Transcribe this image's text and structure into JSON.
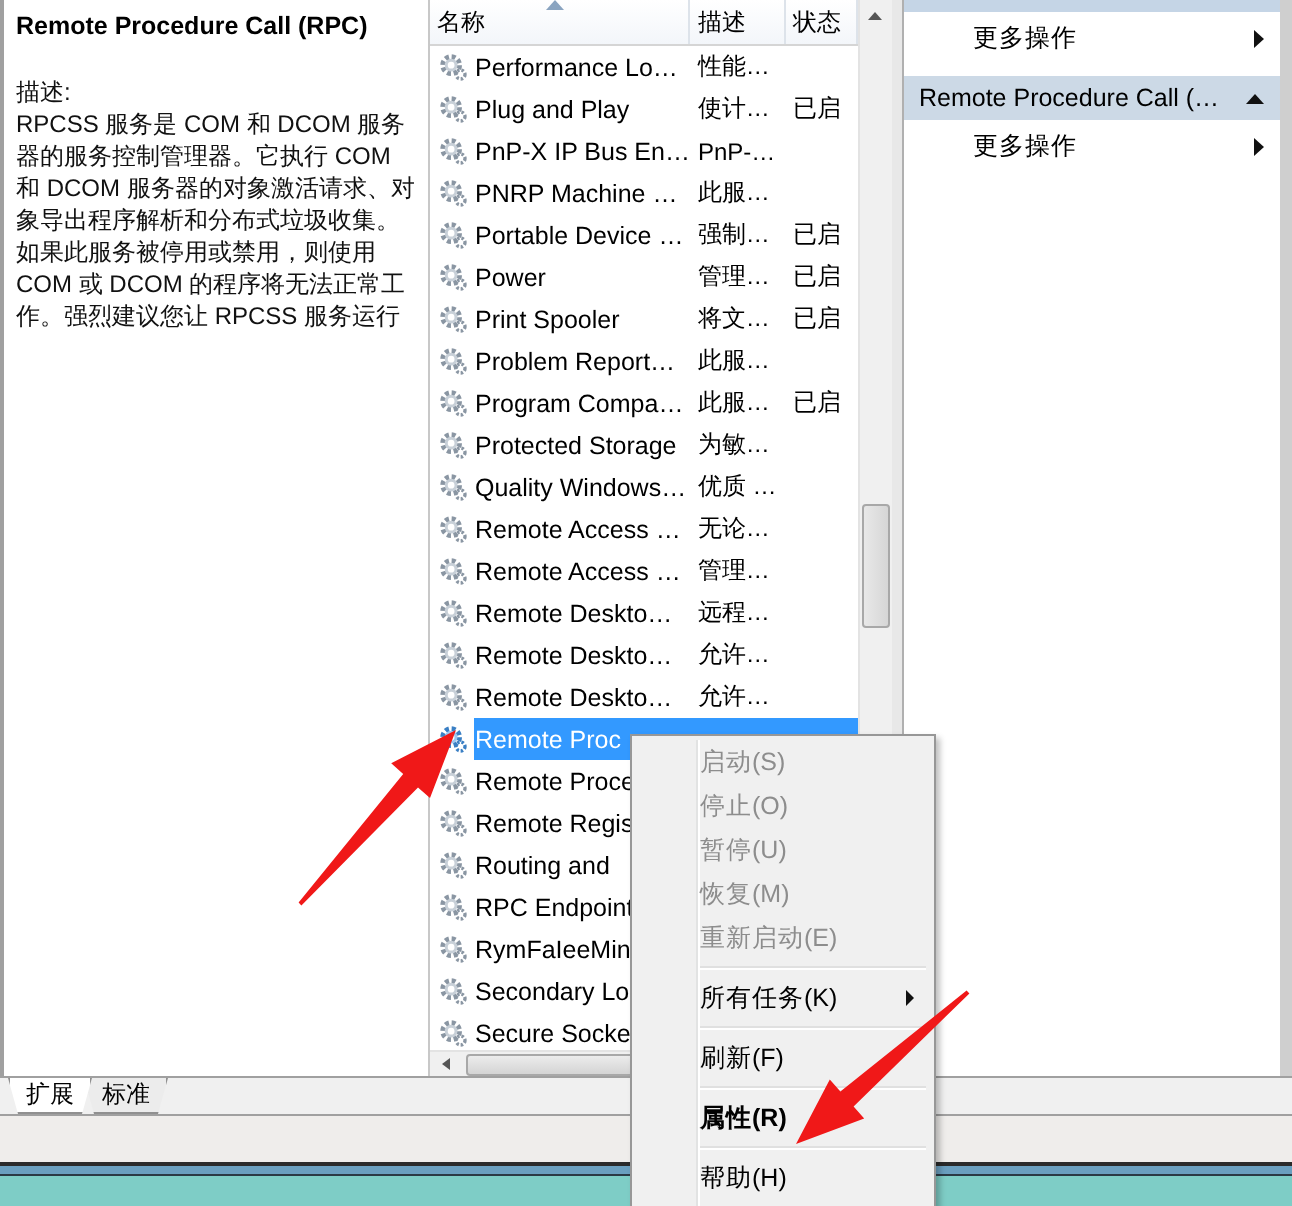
{
  "detail_pane": {
    "title": "Remote Procedure Call (RPC)",
    "description_label": "描述:",
    "description": "RPCSS 服务是 COM 和 DCOM 服务器的服务控制管理器。它执行 COM 和 DCOM 服务器的对象激活请求、对象导出程序解析和分布式垃圾收集。如果此服务被停用或禁用，则使用 COM 或 DCOM 的程序将无法正常工作。强烈建议您让 RPCSS 服务运行"
  },
  "services": {
    "columns": [
      "名称",
      "描述",
      "状态"
    ],
    "rows": [
      {
        "name": "Performance Lo…",
        "description": "性能…",
        "status": "",
        "selected": false
      },
      {
        "name": "Plug and Play",
        "description": "使计…",
        "status": "已启",
        "selected": false
      },
      {
        "name": "PnP-X IP Bus En…",
        "description": "PnP-…",
        "status": "",
        "selected": false
      },
      {
        "name": "PNRP Machine …",
        "description": "此服…",
        "status": "",
        "selected": false
      },
      {
        "name": "Portable Device …",
        "description": "强制…",
        "status": "已启",
        "selected": false
      },
      {
        "name": "Power",
        "description": "管理…",
        "status": "已启",
        "selected": false
      },
      {
        "name": "Print Spooler",
        "description": "将文…",
        "status": "已启",
        "selected": false
      },
      {
        "name": "Problem Report…",
        "description": "此服…",
        "status": "",
        "selected": false
      },
      {
        "name": "Program Compa…",
        "description": "此服…",
        "status": "已启",
        "selected": false
      },
      {
        "name": "Protected Storage",
        "description": "为敏…",
        "status": "",
        "selected": false
      },
      {
        "name": "Quality Windows…",
        "description": "优质 …",
        "status": "",
        "selected": false
      },
      {
        "name": "Remote Access …",
        "description": "无论…",
        "status": "",
        "selected": false
      },
      {
        "name": "Remote Access …",
        "description": "管理…",
        "status": "",
        "selected": false
      },
      {
        "name": "Remote Deskto…",
        "description": "远程…",
        "status": "",
        "selected": false
      },
      {
        "name": "Remote Deskto…",
        "description": "允许…",
        "status": "",
        "selected": false
      },
      {
        "name": "Remote Deskto…",
        "description": "允许…",
        "status": "",
        "selected": false
      },
      {
        "name": "Remote Proc",
        "description": "",
        "status": "",
        "selected": true
      },
      {
        "name": "Remote Proce",
        "description": "",
        "status": "",
        "selected": false
      },
      {
        "name": "Remote Regis",
        "description": "",
        "status": "",
        "selected": false
      },
      {
        "name": "Routing and",
        "description": "",
        "status": "",
        "selected": false
      },
      {
        "name": "RPC Endpoint",
        "description": "",
        "status": "",
        "selected": false
      },
      {
        "name": "RymFaIeeMin",
        "description": "",
        "status": "",
        "selected": false
      },
      {
        "name": "Secondary Lo",
        "description": "",
        "status": "",
        "selected": false
      },
      {
        "name": "Secure Socke",
        "description": "",
        "status": "",
        "selected": false
      }
    ]
  },
  "actions_pane": {
    "items": [
      {
        "kind": "action",
        "label": "更多操作"
      },
      {
        "kind": "header",
        "label": "Remote Procedure Call (…",
        "expanded": true
      },
      {
        "kind": "action",
        "label": "更多操作"
      }
    ]
  },
  "view_tabs": [
    {
      "label": "扩展",
      "selected": true
    },
    {
      "label": "标准",
      "selected": false
    }
  ],
  "context_menu": {
    "items": [
      {
        "kind": "item",
        "label": "启动(S)",
        "disabled": true,
        "default": false,
        "submenu": false
      },
      {
        "kind": "item",
        "label": "停止(O)",
        "disabled": true,
        "default": false,
        "submenu": false
      },
      {
        "kind": "item",
        "label": "暂停(U)",
        "disabled": true,
        "default": false,
        "submenu": false
      },
      {
        "kind": "item",
        "label": "恢复(M)",
        "disabled": true,
        "default": false,
        "submenu": false
      },
      {
        "kind": "item",
        "label": "重新启动(E)",
        "disabled": true,
        "default": false,
        "submenu": false
      },
      {
        "kind": "separator"
      },
      {
        "kind": "item",
        "label": "所有任务(K)",
        "disabled": false,
        "default": false,
        "submenu": true
      },
      {
        "kind": "separator"
      },
      {
        "kind": "item",
        "label": "刷新(F)",
        "disabled": false,
        "default": false,
        "submenu": false
      },
      {
        "kind": "separator"
      },
      {
        "kind": "item",
        "label": "属性(R)",
        "disabled": false,
        "default": true,
        "submenu": false
      },
      {
        "kind": "separator"
      },
      {
        "kind": "item",
        "label": "帮助(H)",
        "disabled": false,
        "default": false,
        "submenu": false
      }
    ]
  },
  "annotations": [
    {
      "kind": "arrow"
    },
    {
      "kind": "arrow"
    }
  ]
}
